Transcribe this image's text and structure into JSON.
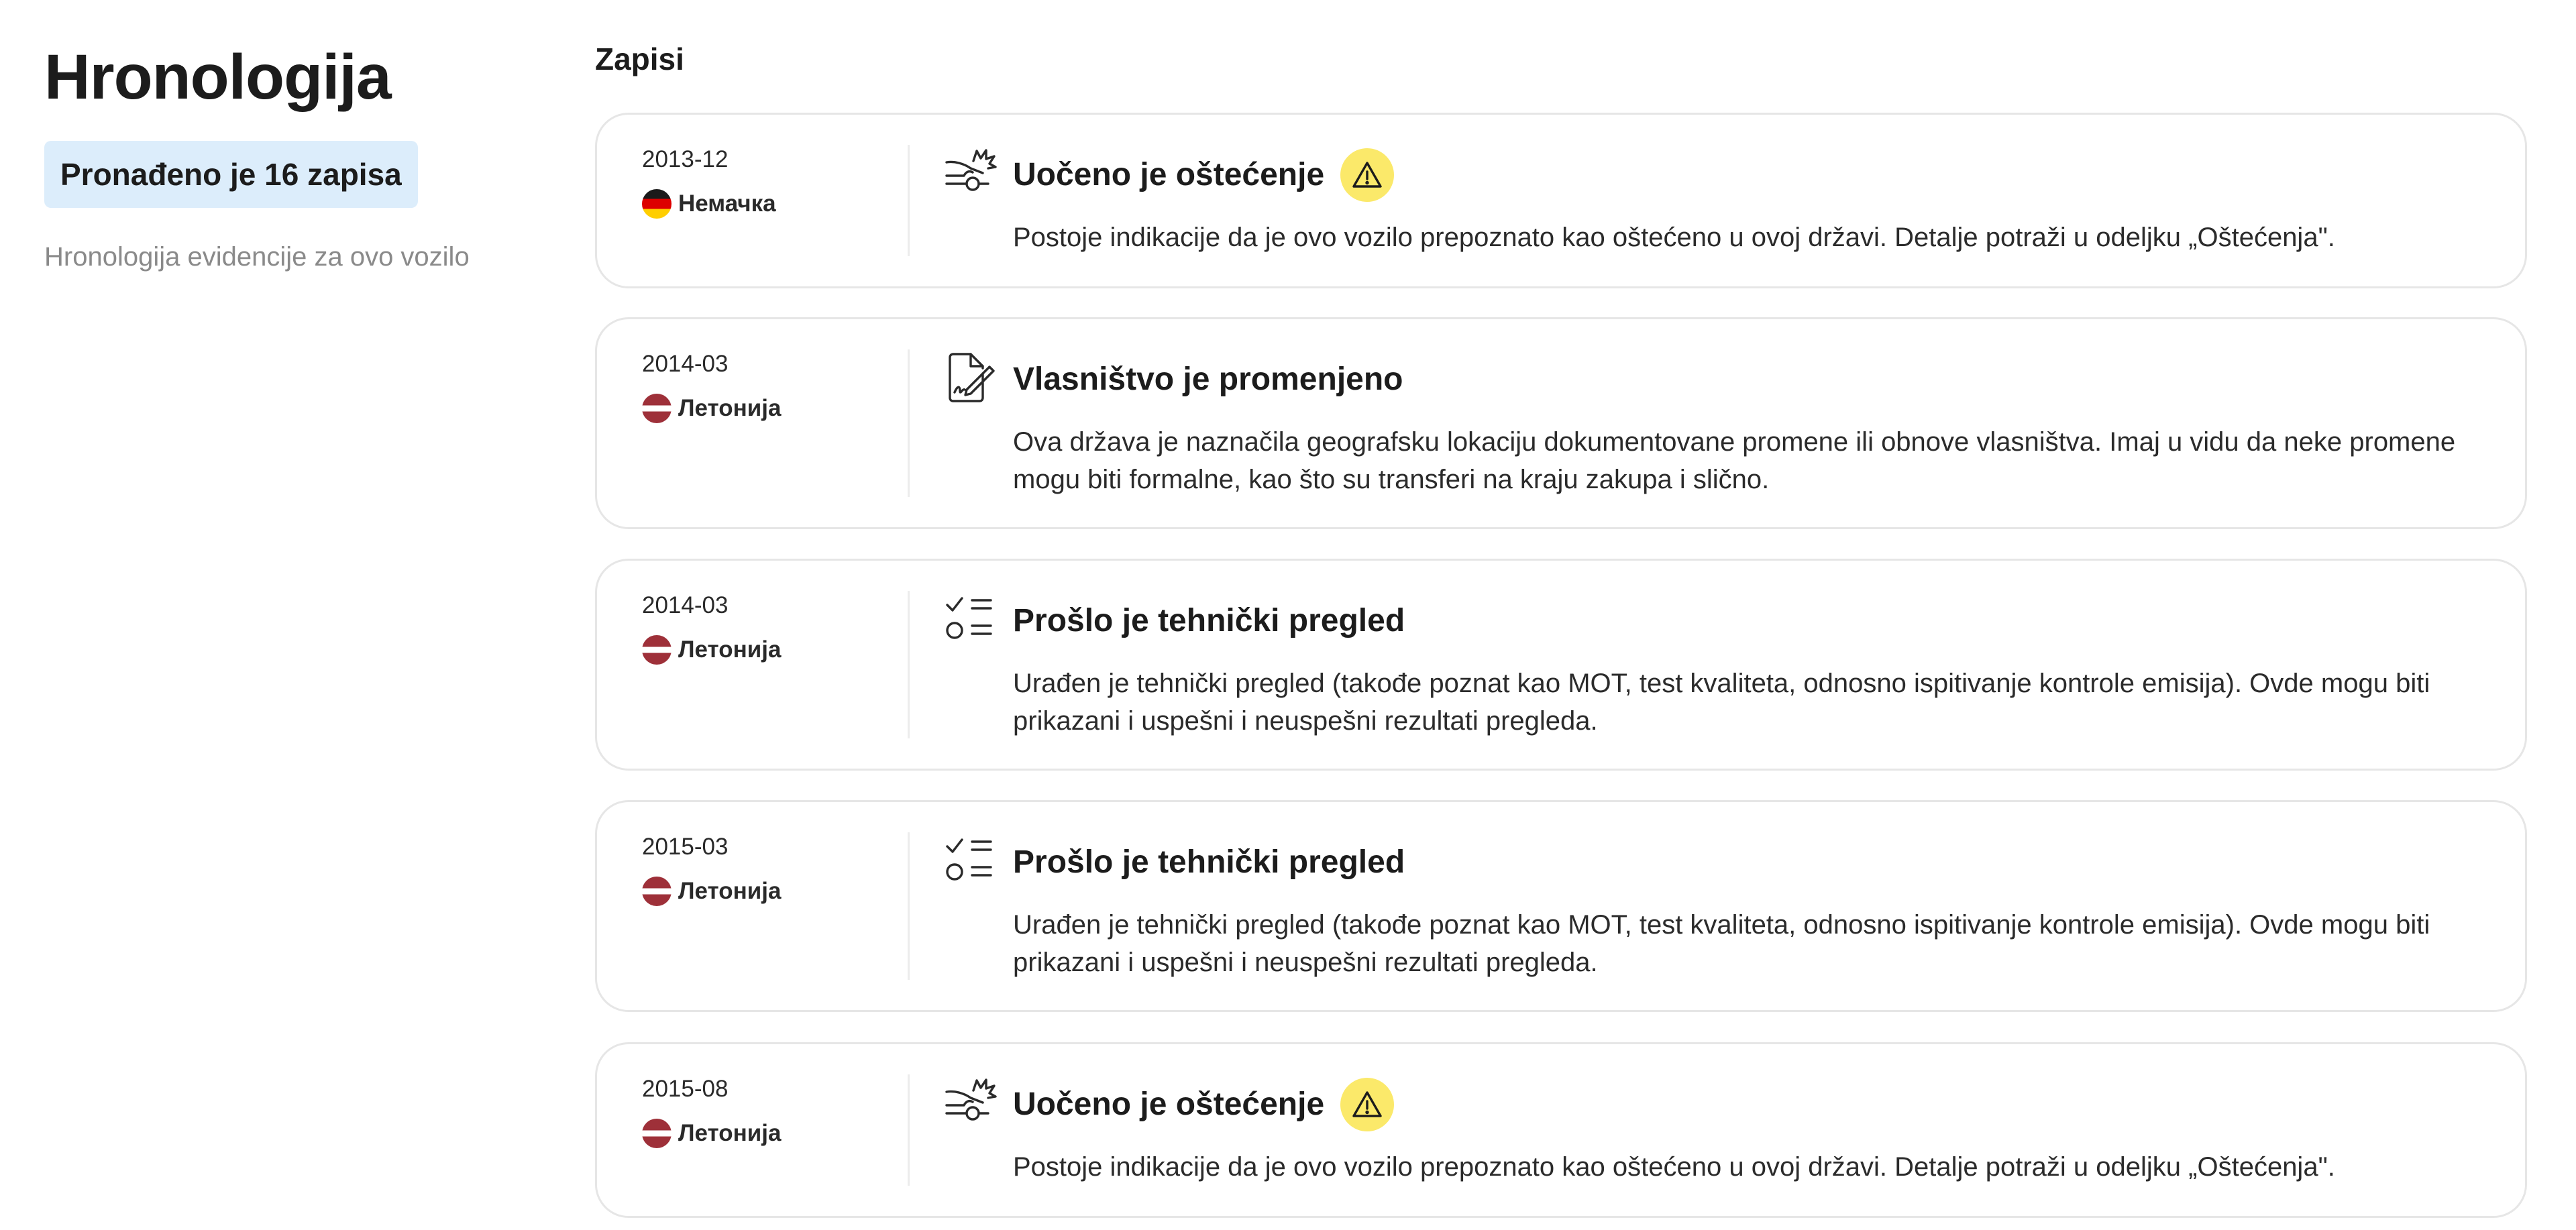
{
  "sidebar": {
    "title": "Hronologija",
    "count_badge": "Pronađeno je 16 zapisa",
    "description": "Hronologija evidencije za ovo vozilo"
  },
  "main": {
    "section_title": "Zapisi",
    "records": [
      {
        "date": "2013-12",
        "country": "Немачка",
        "flag": "germany-flag",
        "icon": "car-crash-icon",
        "title": "Uočeno je oštećenje",
        "warning": true,
        "description": "Postoje indikacije da je ovo vozilo prepoznato kao oštećeno u ovoj državi. Detalje potraži u odeljku „Oštećenja\"."
      },
      {
        "date": "2014-03",
        "country": "Летонија",
        "flag": "latvia-flag",
        "icon": "document-signature-icon",
        "title": "Vlasništvo je promenjeno",
        "warning": false,
        "description": "Ova država je naznačila geografsku lokaciju dokumentovane promene ili obnove vlasništva. Imaj u vidu da neke promene mogu biti formalne, kao što su transferi na kraju zakupa i slično."
      },
      {
        "date": "2014-03",
        "country": "Летонија",
        "flag": "latvia-flag",
        "icon": "checklist-icon",
        "title": "Prošlo je tehnički pregled",
        "warning": false,
        "description": "Urađen je tehnički pregled (takođe poznat kao MOT, test kvaliteta, odnosno ispitivanje kontrole emisija). Ovde mogu biti prikazani i uspešni i neuspešni rezultati pregleda."
      },
      {
        "date": "2015-03",
        "country": "Летонија",
        "flag": "latvia-flag",
        "icon": "checklist-icon",
        "title": "Prošlo je tehnički pregled",
        "warning": false,
        "description": "Urađen je tehnički pregled (takođe poznat kao MOT, test kvaliteta, odnosno ispitivanje kontrole emisija). Ovde mogu biti prikazani i uspešni i neuspešni rezultati pregleda."
      },
      {
        "date": "2015-08",
        "country": "Летонија",
        "flag": "latvia-flag",
        "icon": "car-crash-icon",
        "title": "Uočeno je oštećenje",
        "warning": true,
        "description": "Postoje indikacije da je ovo vozilo prepoznato kao oštećeno u ovoj državi. Detalje potraži u odeljku „Oštećenja\"."
      }
    ]
  },
  "colors": {
    "badge_bg": "#dcedfb",
    "warning": "#fbe96a",
    "card_border": "#e6e6e6",
    "muted_text": "#8a8a8a"
  }
}
